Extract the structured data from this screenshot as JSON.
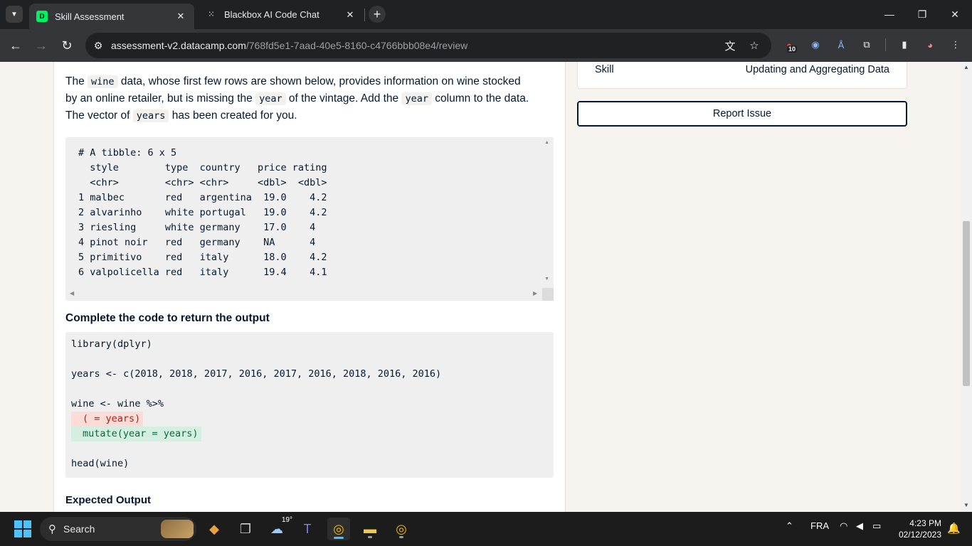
{
  "browser": {
    "tabs": [
      {
        "title": "Skill Assessment",
        "favicon": "datacamp-icon",
        "active": true
      },
      {
        "title": "Blackbox AI Code Chat",
        "favicon": "blackbox-icon",
        "active": false
      }
    ],
    "url_host": "assessment-v2.datacamp.com",
    "url_path": "/768fd5e1-7aad-40e5-8160-c4766bbb08e4/review",
    "extension_badge": "10"
  },
  "prompt": {
    "part1": "The ",
    "code1": "wine",
    "part2": " data, whose first few rows are shown below, provides information on wine stocked by an online retailer, but is missing the ",
    "code2": "year",
    "part3": " of the vintage. Add the ",
    "code3": "year",
    "part4": " column to the data. The vector of ",
    "code4": "years",
    "part5": " has been created for you."
  },
  "tibble_output": "# A tibble: 6 x 5\n  style        type  country   price rating\n  <chr>        <chr> <chr>     <dbl>  <dbl>\n1 malbec       red   argentina  19.0    4.2\n2 alvarinho    white portugal   19.0    4.2\n3 riesling     white germany    17.0    4  \n4 pinot noir   red   germany    NA      4  \n5 primitivo    red   italy      18.0    4.2\n6 valpolicella red   italy      19.4    4.1",
  "code_section": {
    "title": "Complete the code to return the output",
    "lines": {
      "l1": "library(dplyr)",
      "l2": "years <- c(2018, 2018, 2017, 2016, 2017, 2016, 2018, 2016, 2016)",
      "l3": "wine <- wine %>%",
      "removed": "( = years)",
      "added": "mutate(year = years)",
      "l4": "head(wine)"
    }
  },
  "expected_output_title": "Expected Output",
  "sidebar": {
    "skill_label": "Skill",
    "skill_value": "Updating and Aggregating Data",
    "report_button": "Report Issue"
  },
  "taskbar": {
    "search_label": "Search",
    "weather_temp": "19°",
    "language": "FRA",
    "time": "4:23 PM",
    "date": "02/12/2023"
  }
}
